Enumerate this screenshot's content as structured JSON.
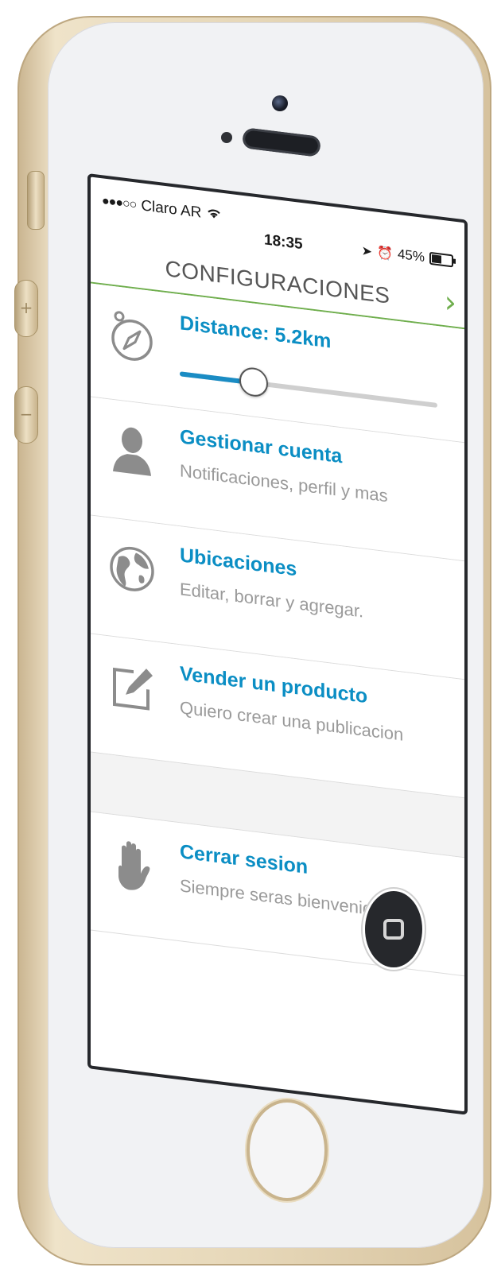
{
  "status_bar": {
    "signal": "●●●○○",
    "carrier": "Claro AR",
    "time": "18:35",
    "battery": "45%"
  },
  "nav": {
    "title": "CONFIGURACIONES"
  },
  "distance": {
    "label": "Distance: 5.2km",
    "slider_value": 0.28
  },
  "menu_items": [
    {
      "title": "Gestionar cuenta",
      "subtitle": "Notificaciones, perfil y mas",
      "icon": "user-icon"
    },
    {
      "title": "Ubicaciones",
      "subtitle": "Editar, borrar y agregar.",
      "icon": "globe-icon"
    },
    {
      "title": "Vender un producto",
      "subtitle": "Quiero crear una publicacion",
      "icon": "edit-icon"
    }
  ],
  "logout": {
    "title": "Cerrar sesion",
    "subtitle": "Siempre seras bienvenido!",
    "icon": "hand-icon"
  },
  "colors": {
    "accent": "#0b8ec4",
    "nav_line": "#6fae4d",
    "slider_fill": "#1a8cc4"
  }
}
